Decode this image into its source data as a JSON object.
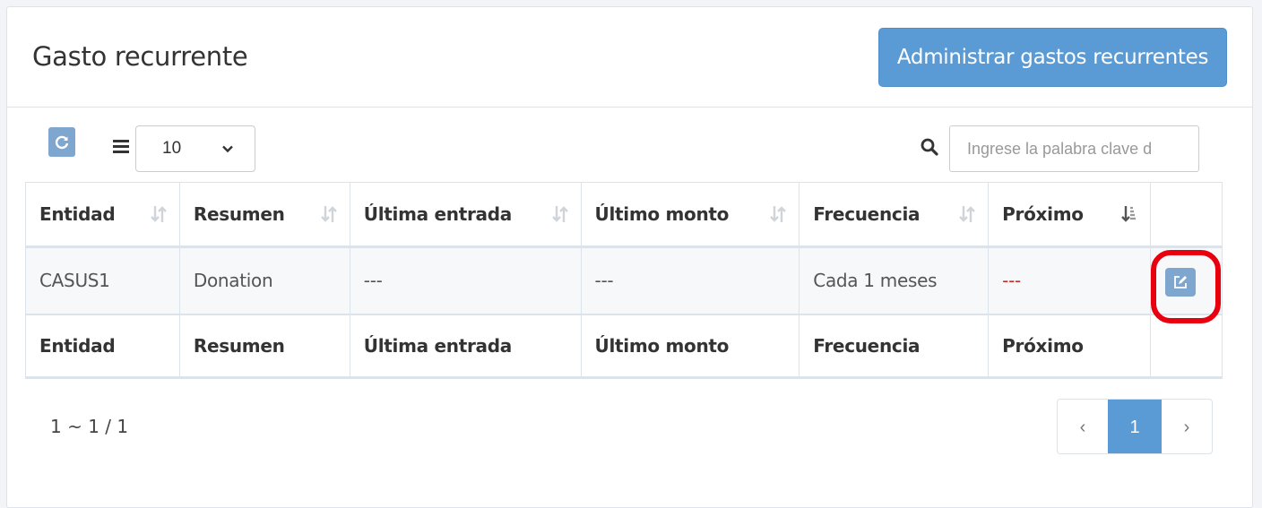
{
  "panel": {
    "title": "Gasto recurrente",
    "manage_button": "Administrar gastos recurrentes"
  },
  "toolbar": {
    "page_size": "10",
    "search_placeholder": "Ingrese la palabra clave d"
  },
  "table": {
    "columns": [
      "Entidad",
      "Resumen",
      "Última entrada",
      "Último monto",
      "Frecuencia",
      "Próximo"
    ],
    "rows": [
      [
        "CASUS1",
        "Donation",
        "---",
        "---",
        "Cada 1 meses",
        "---"
      ]
    ]
  },
  "pagination": {
    "info": "1 ~ 1 / 1",
    "prev": "‹",
    "current": "1",
    "next": "›"
  },
  "colors": {
    "accent": "#5b9bd5",
    "highlight": "#e8000f",
    "next_due_dash": "#c9302c"
  }
}
